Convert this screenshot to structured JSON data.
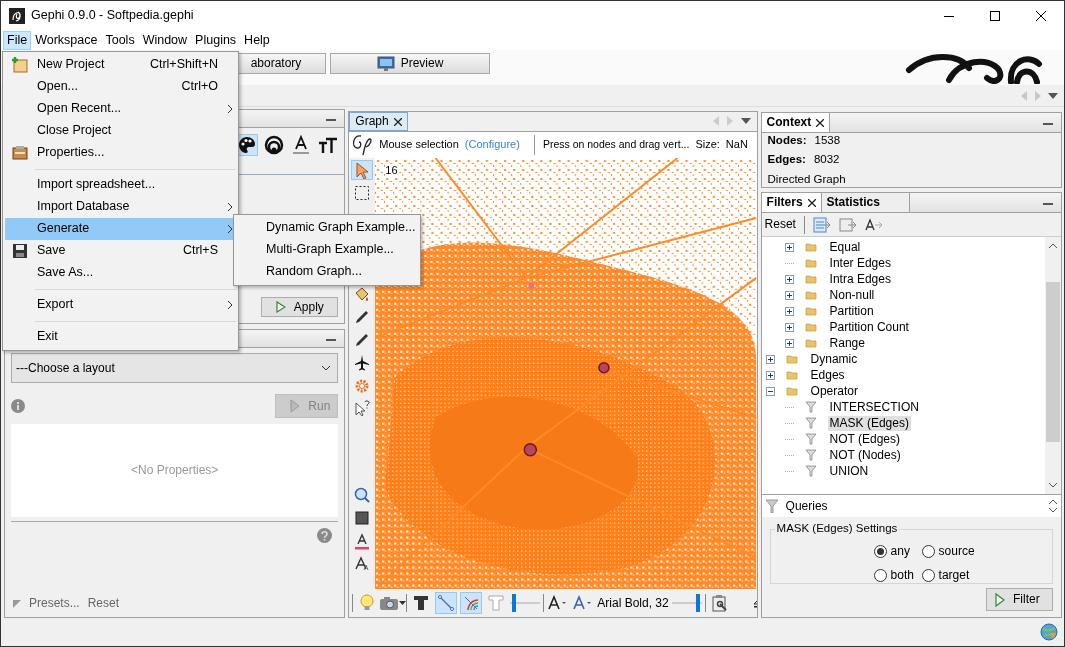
{
  "window": {
    "title": "Gephi 0.9.0 - Softpedia.gephi"
  },
  "menubar": [
    {
      "label": "File",
      "selected": true
    },
    {
      "label": "Workspace",
      "selected": false
    },
    {
      "label": "Tools",
      "selected": false
    },
    {
      "label": "Window",
      "selected": false
    },
    {
      "label": "Plugins",
      "selected": false
    },
    {
      "label": "Help",
      "selected": false
    }
  ],
  "file_menu": {
    "items": [
      {
        "kind": "item",
        "label": "New Project",
        "shortcut": "Ctrl+Shift+N",
        "has_icon": true,
        "submenu": false,
        "selected": false
      },
      {
        "kind": "item",
        "label": "Open...",
        "shortcut": "Ctrl+O",
        "has_icon": false,
        "submenu": false,
        "selected": false
      },
      {
        "kind": "item",
        "label": "Open Recent...",
        "has_icon": false,
        "submenu": true,
        "selected": false
      },
      {
        "kind": "item",
        "label": "Close Project",
        "has_icon": false,
        "submenu": false,
        "selected": false
      },
      {
        "kind": "item",
        "label": "Properties...",
        "has_icon": true,
        "submenu": false,
        "selected": false
      },
      {
        "kind": "separator"
      },
      {
        "kind": "item",
        "label": "Import spreadsheet...",
        "has_icon": false,
        "submenu": false,
        "selected": false
      },
      {
        "kind": "item",
        "label": "Import Database",
        "has_icon": false,
        "submenu": true,
        "selected": false
      },
      {
        "kind": "item",
        "label": "Generate",
        "has_icon": false,
        "submenu": true,
        "selected": true
      },
      {
        "kind": "item",
        "label": "Save",
        "shortcut": "Ctrl+S",
        "has_icon": true,
        "submenu": false,
        "selected": false
      },
      {
        "kind": "item",
        "label": "Save As...",
        "has_icon": false,
        "submenu": false,
        "selected": false
      },
      {
        "kind": "separator"
      },
      {
        "kind": "item",
        "label": "Export",
        "has_icon": false,
        "submenu": true,
        "selected": false
      },
      {
        "kind": "separator"
      },
      {
        "kind": "item",
        "label": "Exit",
        "has_icon": false,
        "submenu": false,
        "selected": false
      }
    ]
  },
  "generate_submenu": [
    "Dynamic Graph Example...",
    "Multi-Graph Example...",
    "Random Graph..."
  ],
  "toolbar": {
    "buttons": [
      {
        "label": "aboratory",
        "has_icon": false
      },
      {
        "label": "Preview",
        "has_icon": true
      }
    ]
  },
  "appearance_panel": {
    "apply_button": "Apply"
  },
  "layout_panel": {
    "select": "---Choose a layout",
    "run_button": {
      "label": "Run",
      "disabled": true
    },
    "properties_placeholder": "<No Properties>",
    "footer": [
      "Presets...",
      "Reset"
    ]
  },
  "graph_panel": {
    "tab": "Graph",
    "mode": "Mouse selection",
    "configure_link": "(Configure)",
    "hint": "Press on nodes and drag vert...",
    "size_label": "Size:",
    "size_value": "NaN",
    "canvas_label": "16",
    "tools": [
      {
        "selected": true
      },
      {
        "selected": false
      },
      {
        "selected": false
      },
      {
        "selected": false
      },
      {
        "selected": false
      },
      {
        "selected": false
      },
      {
        "selected": false
      },
      {
        "selected": false
      }
    ],
    "edge_toggles": [
      {
        "selected": true
      },
      {
        "selected": true
      }
    ],
    "font_label": "Arial Bold, 32"
  },
  "context": {
    "tab": "Context",
    "rows": [
      {
        "label": "Nodes:",
        "value": "1538"
      },
      {
        "label": "Edges:",
        "value": "8032"
      }
    ],
    "graph_type": "Directed Graph"
  },
  "filters": {
    "tabs": [
      {
        "label": "Filters",
        "selected": true,
        "closable": true
      },
      {
        "label": "Statistics",
        "selected": false,
        "closable": false
      }
    ],
    "reset": "Reset",
    "tree": [
      {
        "children": [
          {
            "label": "Equal",
            "kind": "folder",
            "expanded": false,
            "selected": false
          },
          {
            "label": "Inter Edges",
            "kind": "folder",
            "selected": false
          },
          {
            "label": "Intra Edges",
            "kind": "folder",
            "expanded": false,
            "selected": false
          },
          {
            "label": "Non-null",
            "kind": "folder",
            "expanded": false,
            "selected": false
          },
          {
            "label": "Partition",
            "kind": "folder",
            "expanded": false,
            "selected": false
          },
          {
            "label": "Partition Count",
            "kind": "folder",
            "expanded": false,
            "selected": false
          },
          {
            "label": "Range",
            "kind": "folder",
            "expanded": false,
            "selected": false
          }
        ]
      },
      {
        "label": "Dynamic",
        "kind": "folder",
        "expanded": false,
        "selected": false
      },
      {
        "label": "Edges",
        "kind": "folder",
        "expanded": false,
        "selected": false
      },
      {
        "label": "Operator",
        "kind": "folder",
        "expanded": true,
        "selected": false,
        "children": [
          {
            "label": "INTERSECTION",
            "kind": "filter",
            "selected": false
          },
          {
            "label": "MASK (Edges)",
            "kind": "filter",
            "selected": true
          },
          {
            "label": "NOT (Edges)",
            "kind": "filter",
            "selected": false
          },
          {
            "label": "NOT (Nodes)",
            "kind": "filter",
            "selected": false
          },
          {
            "label": "UNION",
            "kind": "filter",
            "selected": false
          }
        ]
      }
    ],
    "queries": "Queries",
    "settings": {
      "title": "MASK (Edges) Settings",
      "options": [
        {
          "label": "any",
          "selected": true
        },
        {
          "label": "source",
          "selected": false
        },
        {
          "label": "both",
          "selected": false
        },
        {
          "label": "target",
          "selected": false
        }
      ]
    },
    "filter_button": "Filter"
  }
}
